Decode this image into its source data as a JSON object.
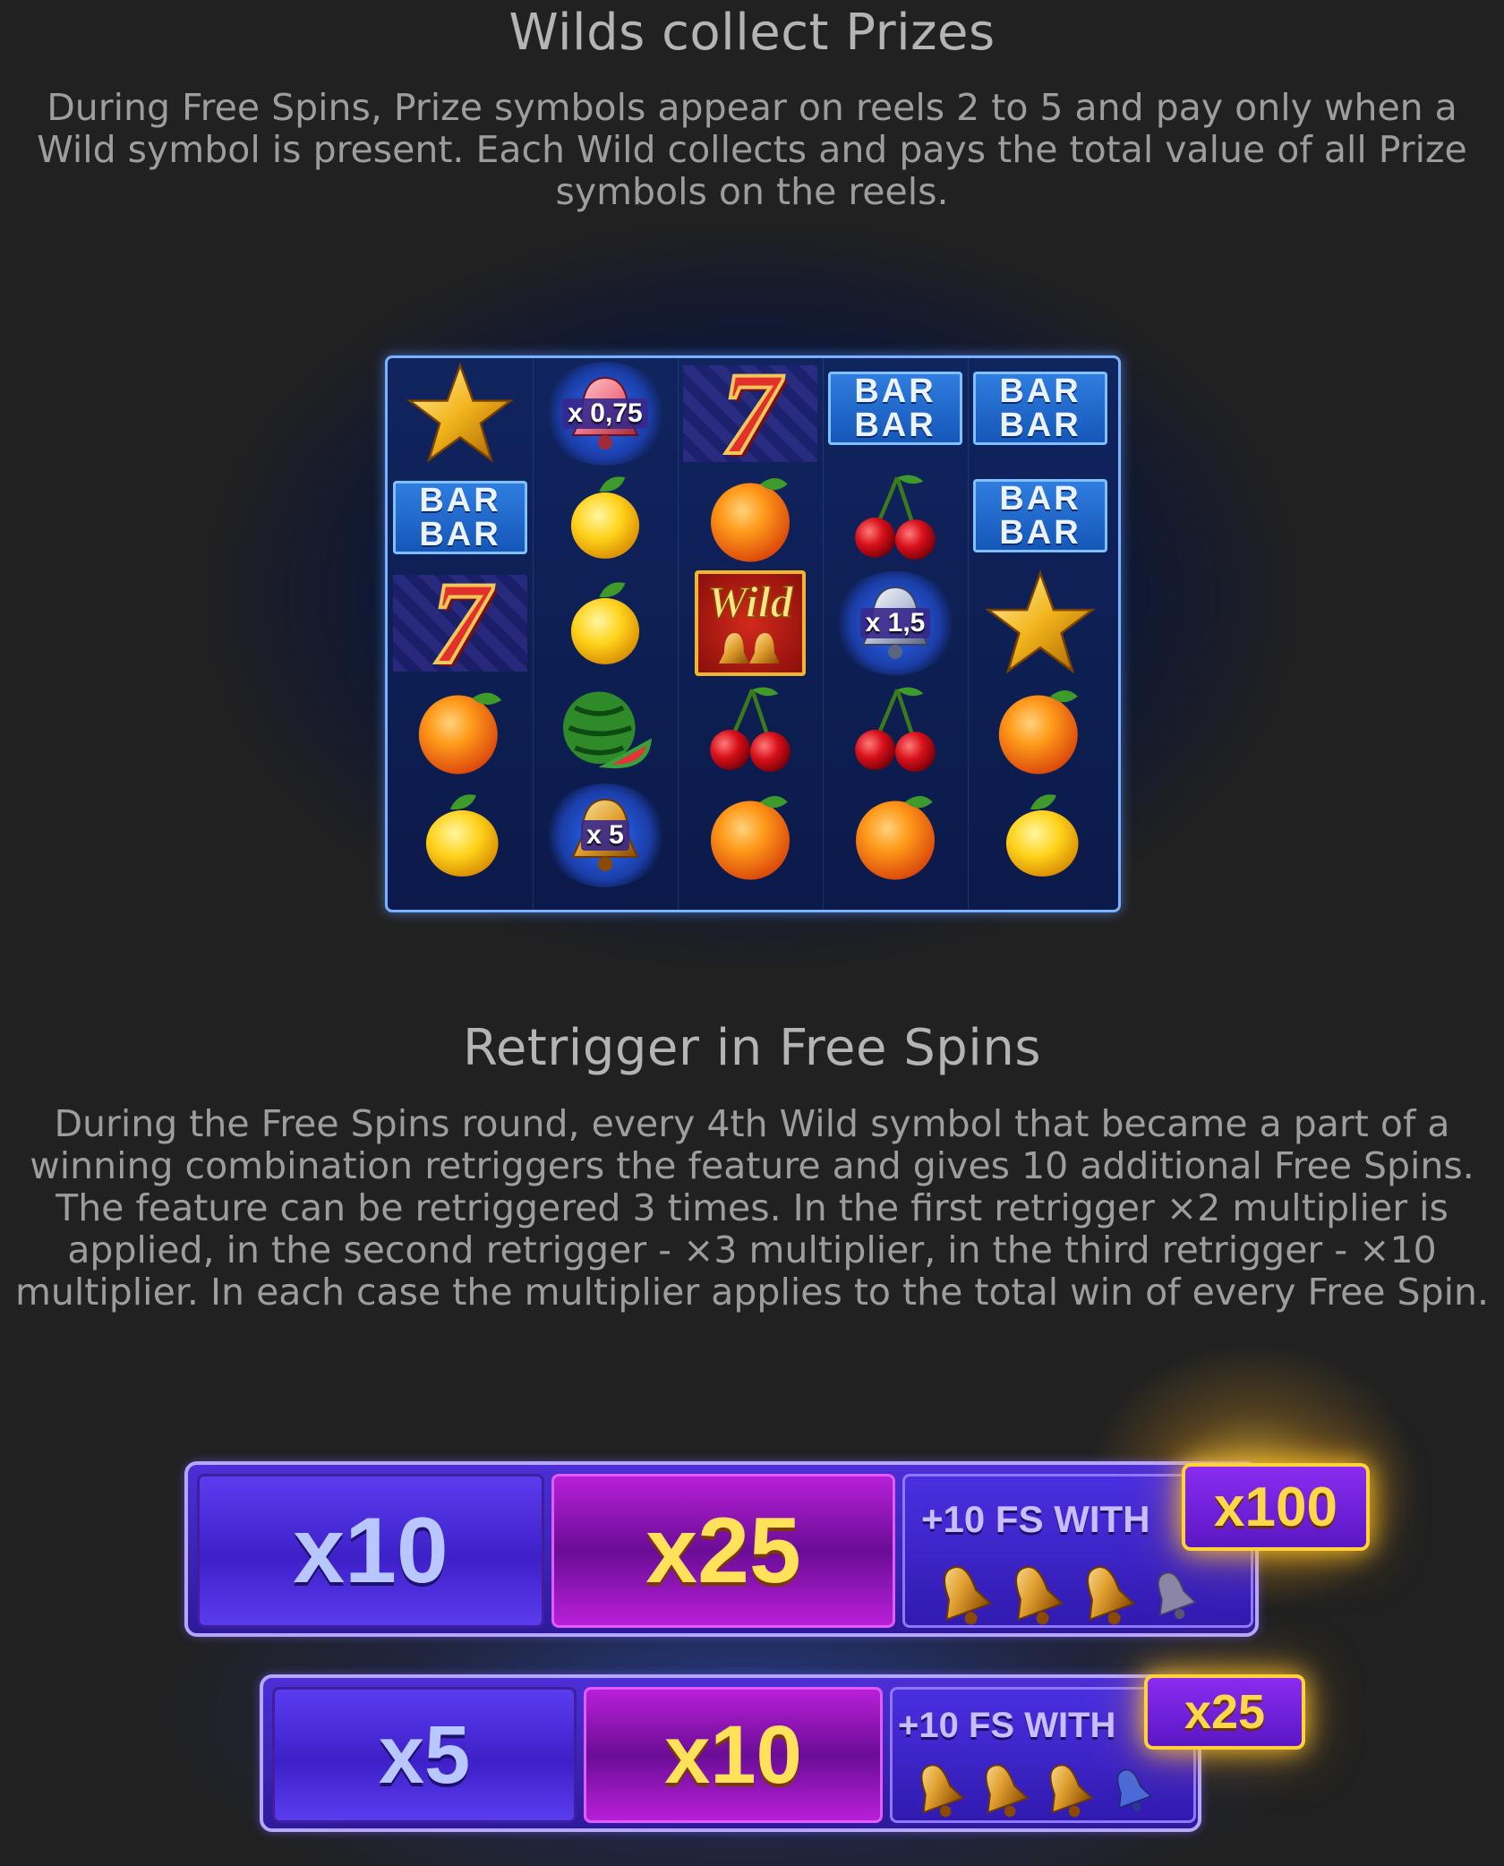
{
  "section1": {
    "title": "Wilds collect Prizes",
    "text": "During Free Spins, Prize symbols appear on reels 2 to 5 and pay only when a Wild symbol is present. Each Wild collects and pays the total value of all Prize symbols on the reels."
  },
  "reels": {
    "bar_word": "BAR",
    "wild_label": "Wild",
    "prizes": [
      "x 0,75",
      "x 1,5",
      "x 5"
    ],
    "symbols": [
      [
        "star",
        "bar",
        "seven",
        "orange",
        "lemon"
      ],
      [
        "prize-bell",
        "lemon",
        "lemon",
        "watermelon",
        "prize-bell"
      ],
      [
        "seven",
        "orange",
        "wild",
        "cherry",
        "orange"
      ],
      [
        "bar",
        "cherry",
        "prize-bell",
        "cherry",
        "orange"
      ],
      [
        "bar",
        "bar",
        "star",
        "orange",
        "lemon"
      ]
    ]
  },
  "section2": {
    "title": "Retrigger in Free Spins",
    "text": "During the Free Spins round, every 4th Wild symbol that became a part of a winning combination retriggers the feature and gives 10 additional Free Spins. The feature can be retriggered 3 times. In the first retrigger ×2 multiplier is applied, in the second retrigger - ×3 multiplier, in the third retrigger - ×10 multiplier. In each case the multiplier applies to the total win of every Free Spin."
  },
  "panels": [
    {
      "mult_a": "x10",
      "mult_b": "x25",
      "fs_label": "+10 FS WITH",
      "badge": "x100",
      "bells_gold": 3,
      "bells_total": 4
    },
    {
      "mult_a": "x5",
      "mult_b": "x10",
      "fs_label": "+10 FS WITH",
      "badge": "x25",
      "bells_gold": 3,
      "bells_total": 4
    }
  ],
  "colors": {
    "background": "#212121",
    "reel_bg": "#10245e",
    "panel_blue": "#4c2fd6",
    "panel_purple": "#b81fd8",
    "gold": "#ffd84a"
  }
}
